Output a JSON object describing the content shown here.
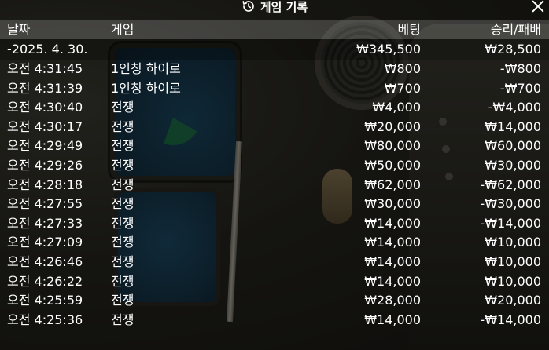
{
  "dialog": {
    "title": "게임 기록",
    "history_icon": "history-icon",
    "close_icon": "close-icon"
  },
  "table": {
    "columns": [
      "날짜",
      "게임",
      "베팅",
      "승리/패배"
    ],
    "date_group": {
      "date": "-2025. 4. 30.",
      "bet_total": "₩345,500",
      "result_total": "₩28,500"
    },
    "rows": [
      {
        "time": "오전 4:31:45",
        "game": "1인칭 하이로",
        "bet": "₩800",
        "result": "-₩800"
      },
      {
        "time": "오전 4:31:39",
        "game": "1인칭 하이로",
        "bet": "₩700",
        "result": "-₩700"
      },
      {
        "time": "오전 4:30:40",
        "game": "전쟁",
        "bet": "₩4,000",
        "result": "-₩4,000"
      },
      {
        "time": "오전 4:30:17",
        "game": "전쟁",
        "bet": "₩20,000",
        "result": "₩14,000"
      },
      {
        "time": "오전 4:29:49",
        "game": "전쟁",
        "bet": "₩80,000",
        "result": "₩60,000"
      },
      {
        "time": "오전 4:29:26",
        "game": "전쟁",
        "bet": "₩50,000",
        "result": "₩30,000"
      },
      {
        "time": "오전 4:28:18",
        "game": "전쟁",
        "bet": "₩62,000",
        "result": "-₩62,000"
      },
      {
        "time": "오전 4:27:55",
        "game": "전쟁",
        "bet": "₩30,000",
        "result": "-₩30,000"
      },
      {
        "time": "오전 4:27:33",
        "game": "전쟁",
        "bet": "₩14,000",
        "result": "-₩14,000"
      },
      {
        "time": "오전 4:27:09",
        "game": "전쟁",
        "bet": "₩14,000",
        "result": "₩10,000"
      },
      {
        "time": "오전 4:26:46",
        "game": "전쟁",
        "bet": "₩14,000",
        "result": "₩10,000"
      },
      {
        "time": "오전 4:26:22",
        "game": "전쟁",
        "bet": "₩14,000",
        "result": "₩10,000"
      },
      {
        "time": "오전 4:25:59",
        "game": "전쟁",
        "bet": "₩28,000",
        "result": "₩20,000"
      },
      {
        "time": "오전 4:25:36",
        "game": "전쟁",
        "bet": "₩14,000",
        "result": "-₩14,000"
      }
    ]
  }
}
